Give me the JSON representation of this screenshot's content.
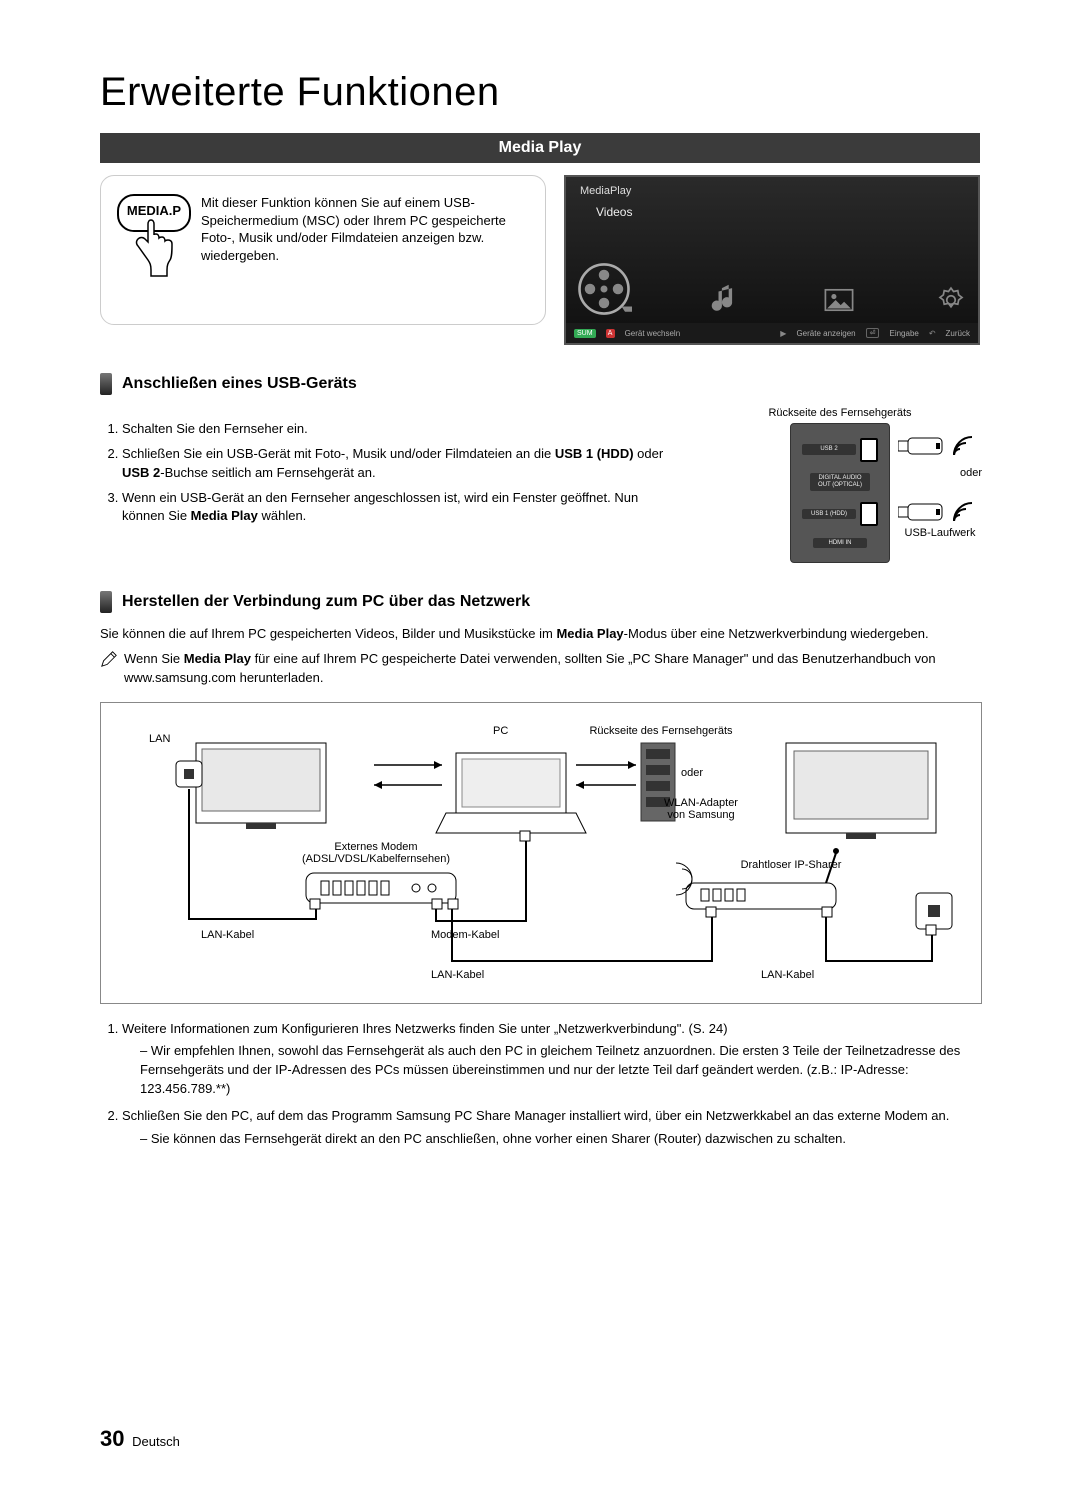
{
  "page_title": "Erweiterte Funktionen",
  "section_title": "Media Play",
  "media_button_label": "MEDIA.P",
  "intro_text": "Mit dieser Funktion können Sie auf einem USB-Speichermedium (MSC) oder Ihrem PC gespeicherte Foto-, Musik und/oder Filmdateien anzeigen bzw. wiedergeben.",
  "tv_preview": {
    "top_label": "MediaPlay",
    "menu_label": "Videos",
    "bottom_left_sum": "SUM",
    "bottom_left_a_label": "Gerät wechseln",
    "bottom_right_items": [
      "Geräte anzeigen",
      "Eingabe",
      "Zurück"
    ]
  },
  "subhead_usb": "Anschließen eines USB-Geräts",
  "usb_steps": [
    {
      "text": "Schalten Sie den Fernseher ein."
    },
    {
      "text_html": "Schließen Sie ein USB-Gerät mit Foto-, Musik und/oder Filmdateien an die <b>USB 1 (HDD)</b> oder <b>USB 2</b>-Buchse seitlich am Fernsehgerät an."
    },
    {
      "text_html": "Wenn ein USB-Gerät an den Fernseher angeschlossen ist, wird ein Fenster geöffnet. Nun können Sie <b>Media Play</b> wählen."
    }
  ],
  "rear_panel": {
    "title": "Rückseite des Fernsehgeräts",
    "port_usb2": "USB 2",
    "port_optical": "DIGITAL AUDIO OUT (OPTICAL)",
    "port_usb1": "USB 1 (HDD)",
    "port_hdmi": "HDMI IN",
    "label_or": "oder",
    "label_usb_drive": "USB-Laufwerk"
  },
  "subhead_network": "Herstellen der Verbindung zum PC über das Netzwerk",
  "network_para_html": "Sie können die auf Ihrem PC gespeicherten Videos, Bilder und Musikstücke im <b>Media Play</b>-Modus über eine Netzwerkverbindung wiedergeben.",
  "network_note_html": "Wenn Sie <b>Media Play</b> für eine auf Ihrem PC gespeicherte Datei verwenden, sollten Sie „PC Share Manager\" und das Benutzerhandbuch von www.samsung.com herunterladen.",
  "diagram_labels": {
    "lan": "LAN",
    "pc": "PC",
    "tv_rear": "Rückseite des Fernsehgeräts",
    "oder": "oder",
    "wlan_adapter": "WLAN-Adapter von Samsung",
    "ext_modem": "Externes Modem\n(ADSL/VDSL/Kabelfernsehen)",
    "wireless_sharer": "Drahtloser IP-Sharer",
    "lan_cable": "LAN-Kabel",
    "modem_cable": "Modem-Kabel"
  },
  "footer_steps": [
    {
      "text": "Weitere Informationen zum Konfigurieren Ihres Netzwerks finden Sie unter „Netzwerkverbindung\". (S. 24)",
      "subs": [
        "Wir empfehlen Ihnen, sowohl das Fernsehgerät als auch den PC in gleichem Teilnetz anzuordnen. Die ersten 3 Teile der Teilnetzadresse des Fernsehgeräts und der IP-Adressen des PCs müssen übereinstimmen und nur der letzte Teil darf geändert werden. (z.B.: IP-Adresse: 123.456.789.**)"
      ]
    },
    {
      "text": "Schließen Sie den PC, auf dem das Programm Samsung PC Share Manager installiert wird, über ein Netzwerkkabel an das externe Modem an.",
      "subs": [
        "Sie können das Fernsehgerät direkt an den PC anschließen, ohne vorher einen Sharer (Router) dazwischen zu schalten."
      ]
    }
  ],
  "page_number": "30",
  "page_lang": "Deutsch"
}
